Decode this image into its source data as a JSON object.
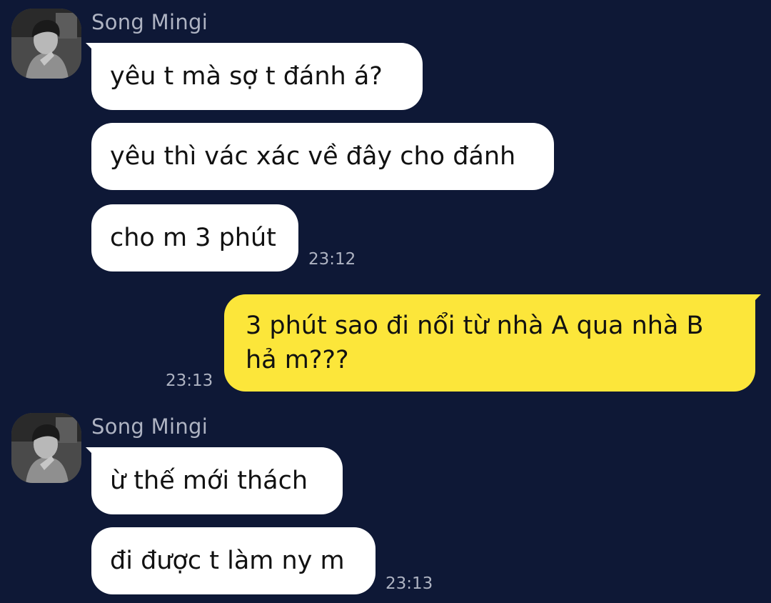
{
  "messages": [
    {
      "sender": "Song Mingi",
      "direction": "incoming",
      "bubbles": [
        "yêu t mà sợ t đánh á?",
        "yêu thì vác xác về đây cho đánh",
        "cho m 3 phút"
      ],
      "time": "23:12"
    },
    {
      "direction": "outgoing",
      "bubbles": [
        "3 phút sao đi nổi từ nhà A qua nhà B hả m???"
      ],
      "time": "23:13"
    },
    {
      "sender": "Song Mingi",
      "direction": "incoming",
      "bubbles": [
        "ừ thế mới thách",
        "đi được t làm ny m"
      ],
      "time": "23:13"
    }
  ],
  "colors": {
    "background": "#0e1836",
    "incoming_bubble": "#ffffff",
    "outgoing_bubble": "#fce63a",
    "meta_text": "#aeb3c2"
  },
  "icons": {
    "avatar": "profile-photo"
  }
}
